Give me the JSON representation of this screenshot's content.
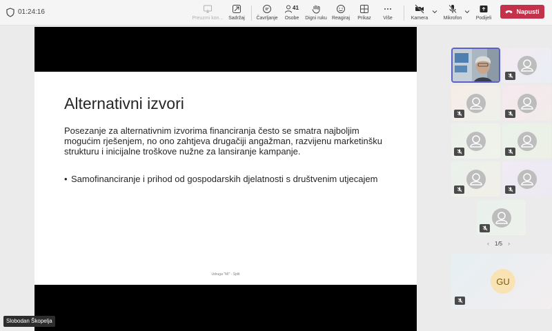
{
  "meeting": {
    "timer": "01:24:16"
  },
  "toolbar": {
    "take_control": "Preuzmi kon...",
    "content": "Sadržaj",
    "chat": "Čavrljanje",
    "people": "Osobe",
    "people_count": "41",
    "raise_hand": "Digni ruku",
    "react": "Reagiraj",
    "view": "Prikaz",
    "more": "Više",
    "camera": "Kamera",
    "mic": "Mikrofon",
    "share": "Podijeli",
    "leave": "Napusti"
  },
  "slide": {
    "title": "Alternativni izvori",
    "body": "Posezanje za alternativnim izvorima financiranja često se smatra najboljim mogućim rješenjem, no ono zahtjeva drugačiji angažman, razvijenu marketinšku strukturu i inicijalne troškove nužne za lansiranje kampanje.",
    "bullet": "Samofinanciranje i prihod od gospodarskih djelatnosti s društvenim utjecajem",
    "bullet_mark": "•",
    "footer": "Udruga \"MI\" - Split"
  },
  "presenter": {
    "name": "Slobodan Škopelja"
  },
  "gallery": {
    "page": "1/5",
    "prev": "‹",
    "next": "›"
  },
  "guest": {
    "initials": "GU"
  },
  "colors": {
    "leave": "#c4314b",
    "active_border": "#5b5fc7"
  }
}
